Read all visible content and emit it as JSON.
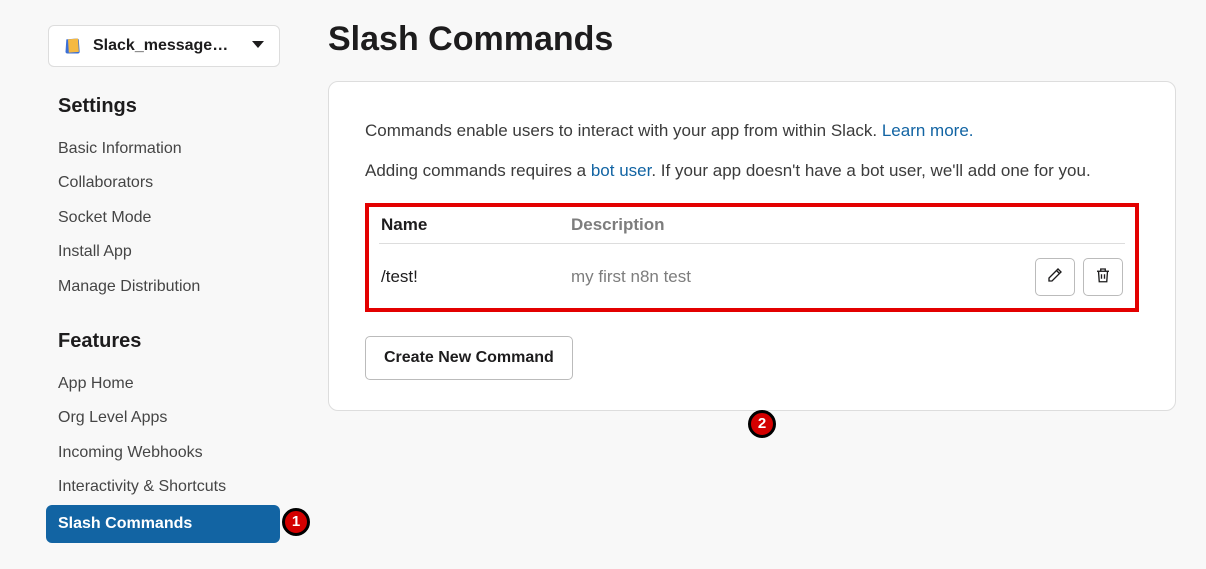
{
  "app_selector": {
    "name": "Slack_message…"
  },
  "sidebar": {
    "settings_title": "Settings",
    "settings_items": [
      "Basic Information",
      "Collaborators",
      "Socket Mode",
      "Install App",
      "Manage Distribution"
    ],
    "features_title": "Features",
    "features_items": [
      "App Home",
      "Org Level Apps",
      "Incoming Webhooks",
      "Interactivity & Shortcuts",
      "Slash Commands"
    ],
    "active_feature_index": 4
  },
  "page": {
    "title": "Slash Commands",
    "intro_pre": "Commands enable users to interact with your app from within Slack. ",
    "learn_more": "Learn more.",
    "intro2_pre": "Adding commands requires a ",
    "bot_user": "bot user",
    "intro2_post": ". If your app doesn't have a bot user, we'll add one for you.",
    "table": {
      "col_name": "Name",
      "col_desc": "Description",
      "rows": [
        {
          "name": "/test!",
          "desc": "my first n8n test"
        }
      ]
    },
    "create_button": "Create New Command"
  },
  "annotations": {
    "badge1": "1",
    "badge2": "2"
  }
}
